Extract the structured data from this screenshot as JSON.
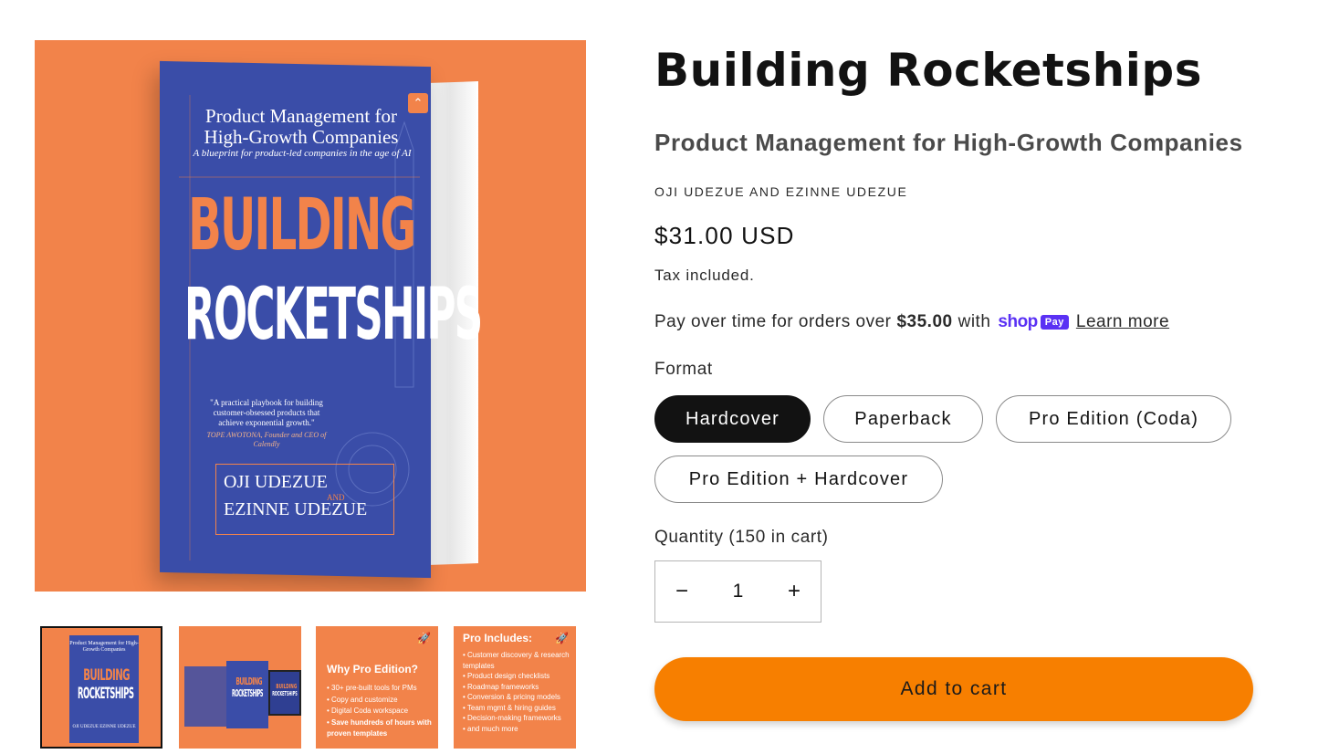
{
  "product": {
    "title": "Building Rocketships",
    "subtitle": "Product Management for High-Growth Companies",
    "vendor": "OJI UDEZUE AND EZINNE UDEZUE",
    "price": "$31.00 USD",
    "tax_note": "Tax included."
  },
  "installments": {
    "prefix": "Pay over time for orders over",
    "threshold": "$35.00",
    "suffix": "with",
    "shop_word": "shop",
    "pay_badge": "Pay",
    "learn_more": "Learn more"
  },
  "format": {
    "label": "Format",
    "options": [
      "Hardcover",
      "Paperback",
      "Pro Edition (Coda)",
      "Pro Edition + Hardcover"
    ],
    "selected": "Hardcover"
  },
  "quantity": {
    "label": "Quantity (150 in cart)",
    "value": "1",
    "minus": "−",
    "plus": "+"
  },
  "cart": {
    "add_label": "Add to cart"
  },
  "cover": {
    "subtitle": "Product Management for High-Growth Companies",
    "tagline": "A blueprint for product-led companies in the age of AI",
    "title_line_1": "BUILDING",
    "title_line_2": "ROCKETSHIPS",
    "quote": "\"A practical playbook for building customer-obsessed products that achieve exponential growth.\"",
    "quote_author": "TOPE AWOTONA, Founder and CEO of Calendly",
    "author_1": "OJI UDEZUE",
    "and": "AND",
    "author_2": "EZINNE UDEZUE"
  },
  "thumbnails": {
    "thumb_1": {
      "subtitle": "Product Management for High-Growth Companies",
      "title_1": "BUILDING",
      "title_2": "ROCKETSHIPS",
      "authors": "OJI UDEZUE EZINNE UDEZUE"
    },
    "thumb_2": {
      "title_1": "BUILDING",
      "title_2": "ROCKETSHIPS",
      "tablet_1": "BUILDING",
      "tablet_2": "ROCKETSHIPS"
    },
    "thumb_3": {
      "heading": "Why Pro Edition?",
      "items": [
        "30+ pre-built tools for PMs",
        "Copy and customize",
        "Digital Coda workspace",
        "Save hundreds of hours with proven templates"
      ]
    },
    "thumb_4": {
      "heading": "Pro Includes:",
      "items": [
        "Customer discovery & research templates",
        "Product design checklists",
        "Roadmap frameworks",
        "Conversion & pricing models",
        "Team mgmt & hiring guides",
        "Decision-making frameworks",
        "and much more"
      ]
    }
  },
  "colors": {
    "brand_orange": "#f2834a",
    "cart_orange": "#f77f00",
    "book_blue": "#3a4da8",
    "shop_purple": "#5a31f4"
  }
}
